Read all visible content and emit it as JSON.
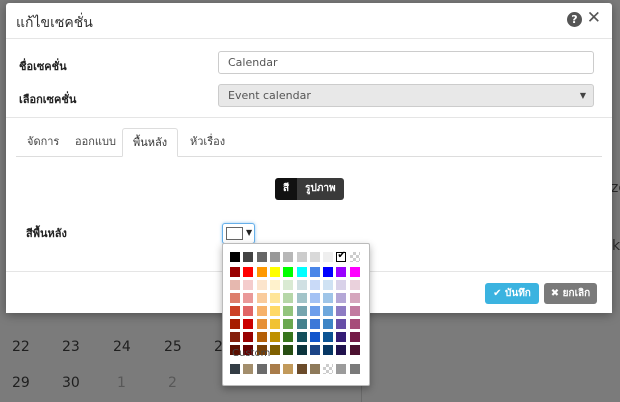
{
  "background_calendar": {
    "rows": [
      [
        "22",
        "23",
        "24",
        "25",
        "2"
      ],
      [
        "29",
        "30",
        "1",
        "2"
      ]
    ],
    "right_fragments": [
      "ze",
      "k"
    ]
  },
  "modal": {
    "title": "แก้ไขเซคชั่น",
    "help_icon": "question-circle-icon",
    "close_icon": "close-icon",
    "fields": {
      "section_name_label": "ชื่อเซคชั่น",
      "section_name_value": "Calendar",
      "section_select_label": "เลือกเซคชั่น",
      "section_select_value": "Event calendar"
    },
    "tabs": [
      "จัดการ",
      "ออกแบบ",
      "พื้นหลัง",
      "หัวเรื่อง"
    ],
    "active_tab": "พื้นหลัง",
    "toggle": {
      "color": "สี",
      "image": "รูปภาพ",
      "active": "สี"
    },
    "background_color_label": "สีพื้นหลัง",
    "current_color": "#ffffff",
    "footer": {
      "save": "บันทึก",
      "cancel": "ยกเลิก"
    }
  },
  "color_picker": {
    "rows": [
      [
        "#000000",
        "#434343",
        "#666666",
        "#999999",
        "#b7b7b7",
        "#cccccc",
        "#d9d9d9",
        "#efefef",
        "#ffffff",
        "transparent"
      ],
      [
        "#980000",
        "#ff0000",
        "#ff9900",
        "#ffff00",
        "#00ff00",
        "#00ffff",
        "#4a86e8",
        "#0000ff",
        "#9900ff",
        "#ff00ff"
      ],
      [
        "#e6b8af",
        "#f4cccc",
        "#fce5cd",
        "#fff2cc",
        "#d9ead3",
        "#d0e0e3",
        "#c9daf8",
        "#cfe2f3",
        "#d9d2e9",
        "#ead1dc"
      ],
      [
        "#dd7e6b",
        "#ea9999",
        "#f9cb9c",
        "#ffe599",
        "#b6d7a8",
        "#a2c4c9",
        "#a4c2f4",
        "#9fc5e8",
        "#b4a7d6",
        "#d5a6bd"
      ],
      [
        "#cc4125",
        "#e06666",
        "#f6b26b",
        "#ffd966",
        "#93c47d",
        "#76a5af",
        "#6d9eeb",
        "#6fa8dc",
        "#8e7cc3",
        "#c27ba0"
      ],
      [
        "#a61c00",
        "#cc0000",
        "#e69138",
        "#f1c232",
        "#6aa84f",
        "#45818e",
        "#3c78d8",
        "#3d85c6",
        "#674ea7",
        "#a64d79"
      ],
      [
        "#85200c",
        "#990000",
        "#b45f06",
        "#bf9000",
        "#38761d",
        "#134f5c",
        "#1155cc",
        "#0b5394",
        "#351c75",
        "#741b47"
      ],
      [
        "#5b0f00",
        "#660000",
        "#783f04",
        "#7f6000",
        "#274e13",
        "#0c343d",
        "#1c4587",
        "#073763",
        "#20124d",
        "#4c1130"
      ]
    ],
    "selected_color": "#ffffff",
    "custom_label": "Custom",
    "custom_row": [
      "#333d45",
      "#a38e6c",
      "#6b6b6b",
      "#a97c4a",
      "#c29a5b",
      "#6b4b2a",
      "#8e7a5a",
      "transparent",
      "#9b9b9b",
      "#7a7a7a"
    ]
  }
}
